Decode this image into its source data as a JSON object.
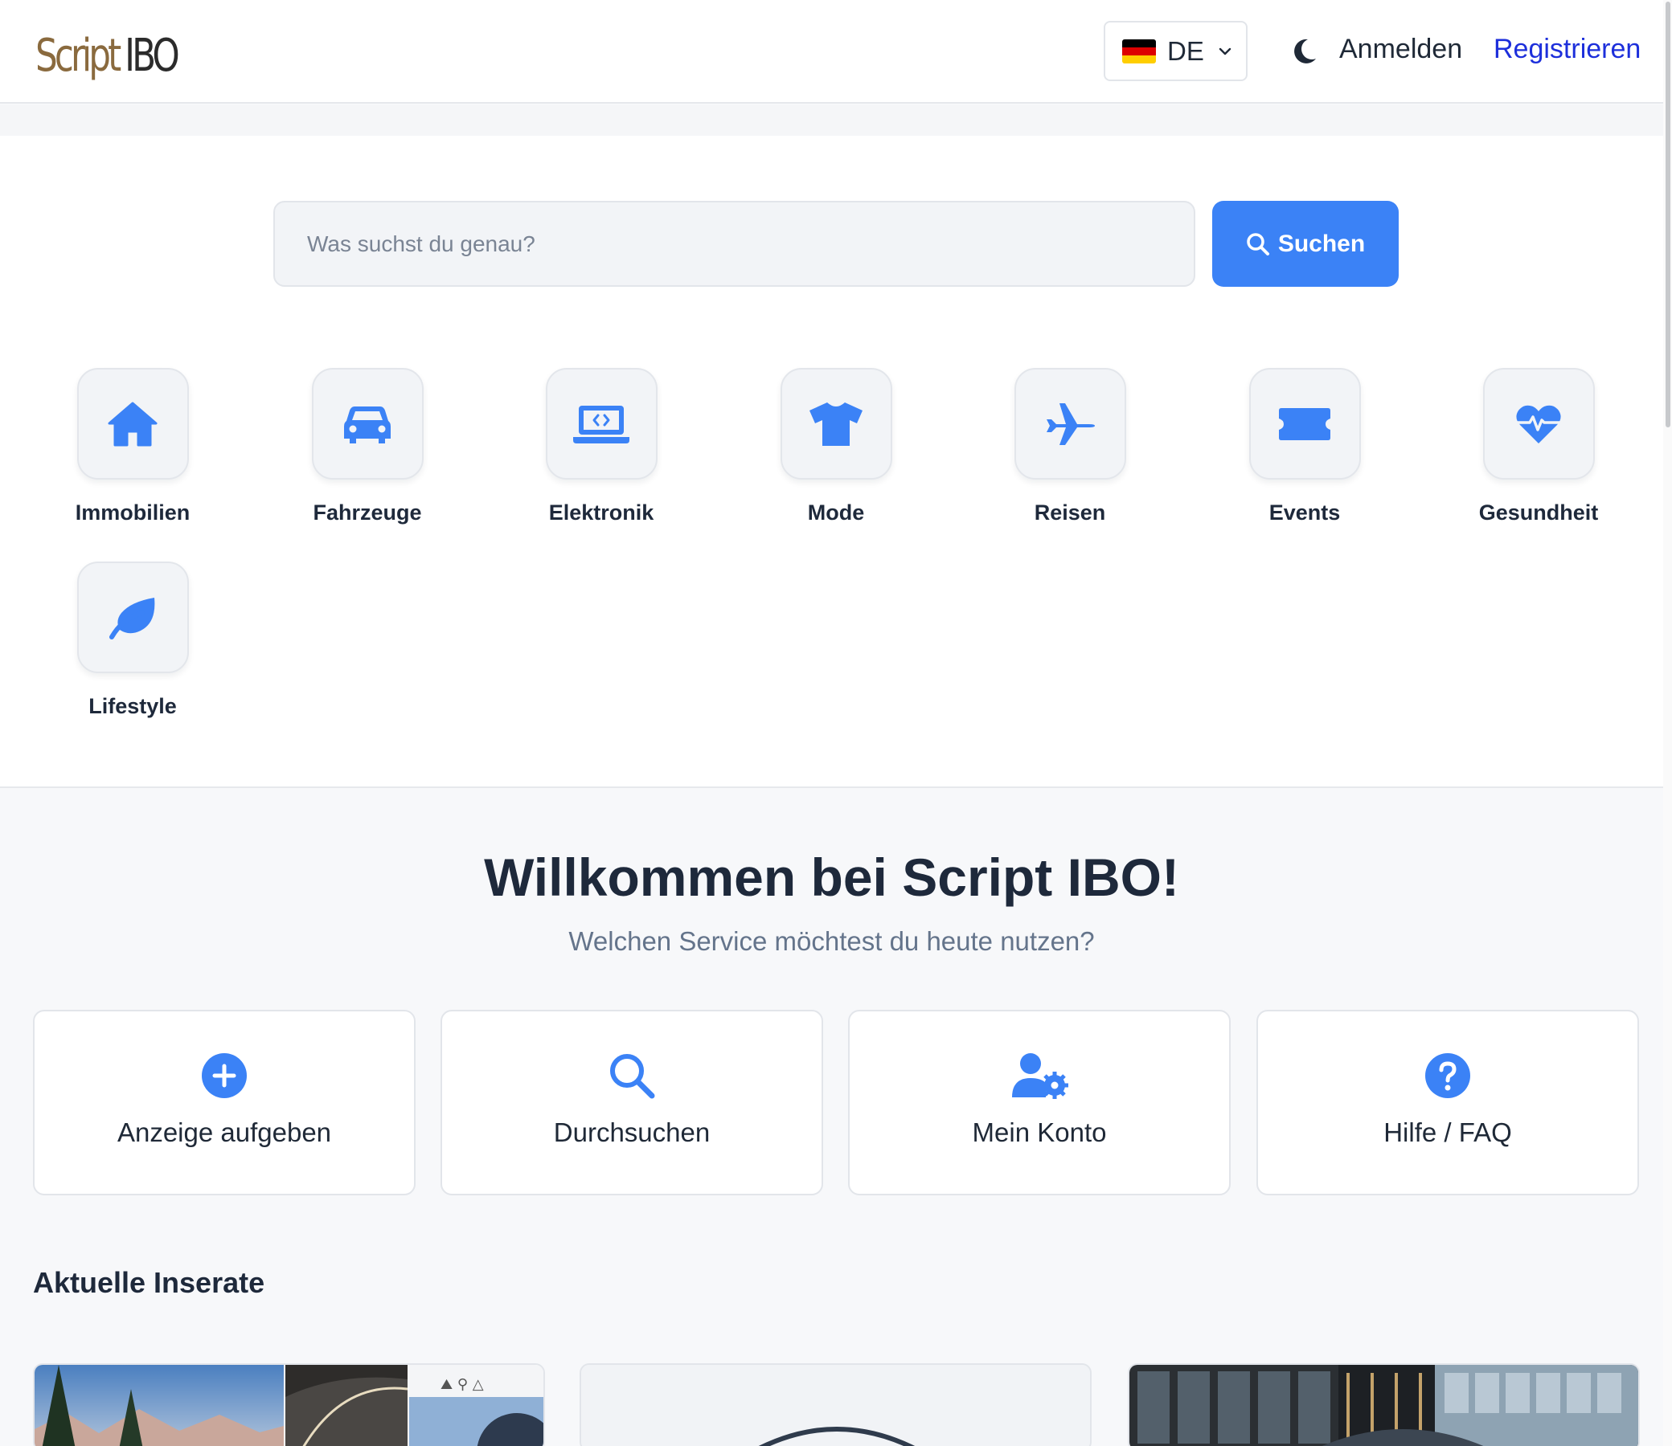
{
  "header": {
    "logo_script": "Script",
    "logo_ibo": "IBO",
    "language": "DE",
    "login": "Anmelden",
    "register": "Registrieren"
  },
  "search": {
    "placeholder": "Was suchst du genau?",
    "button": "Suchen"
  },
  "categories": [
    {
      "label": "Immobilien",
      "icon": "house-icon"
    },
    {
      "label": "Fahrzeuge",
      "icon": "car-icon"
    },
    {
      "label": "Elektronik",
      "icon": "laptop-code-icon"
    },
    {
      "label": "Mode",
      "icon": "shirt-icon"
    },
    {
      "label": "Reisen",
      "icon": "plane-icon"
    },
    {
      "label": "Events",
      "icon": "ticket-icon"
    },
    {
      "label": "Gesundheit",
      "icon": "heart-pulse-icon"
    },
    {
      "label": "Lifestyle",
      "icon": "leaf-icon"
    }
  ],
  "welcome": {
    "title": "Willkommen bei Script IBO!",
    "subtitle": "Welchen Service möchtest du heute nutzen?"
  },
  "actions": [
    {
      "label": "Anzeige aufgeben",
      "icon": "plus-circle-icon"
    },
    {
      "label": "Durchsuchen",
      "icon": "search-icon"
    },
    {
      "label": "Mein Konto",
      "icon": "user-gear-icon"
    },
    {
      "label": "Hilfe / FAQ",
      "icon": "question-circle-icon"
    }
  ],
  "listings": {
    "title": "Aktuelle Inserate"
  },
  "colors": {
    "accent": "#3b82f6",
    "register_link": "#1d2fdb",
    "logo_gold": "#8a6a3e",
    "text_dark": "#1e293b",
    "text_muted": "#64748b"
  }
}
